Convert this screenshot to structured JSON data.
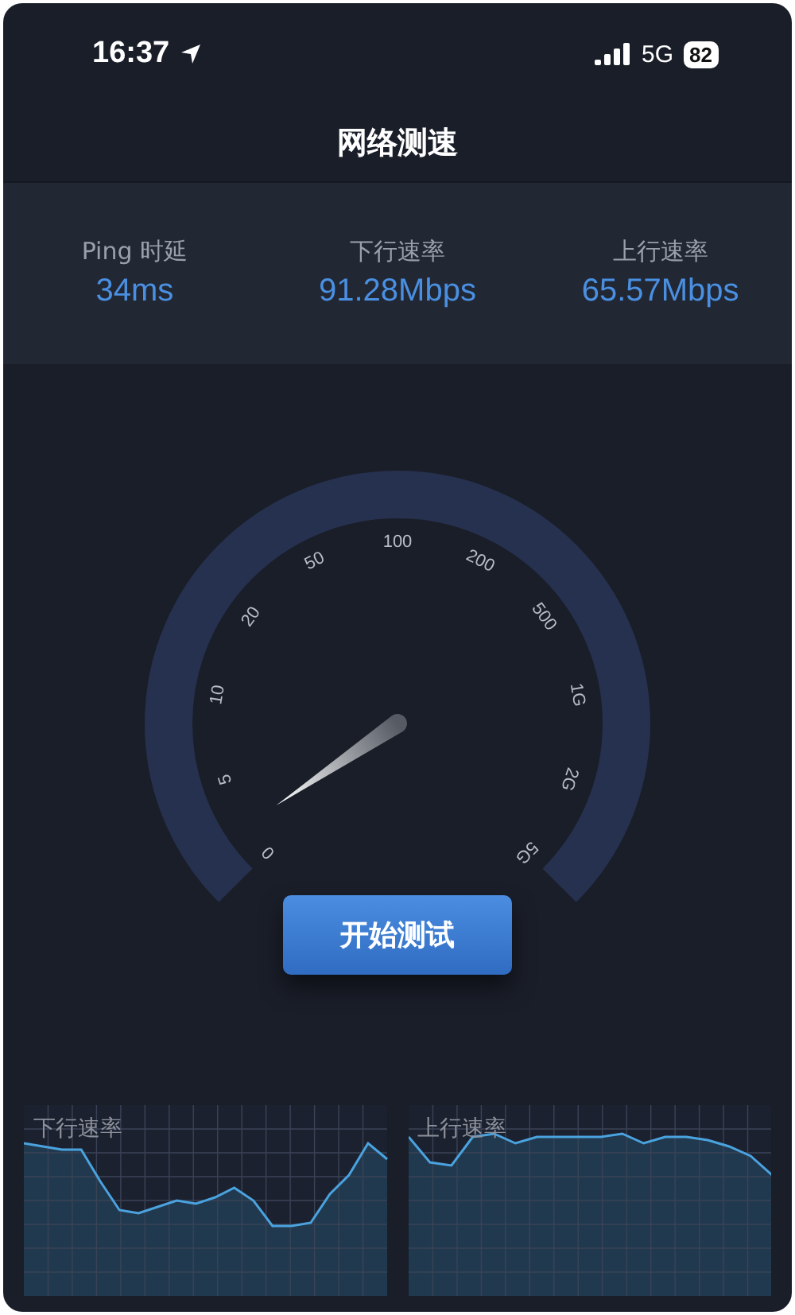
{
  "status_bar": {
    "time": "16:37",
    "network": "5G",
    "battery": "82"
  },
  "title": "网络测速",
  "stats": [
    {
      "label": "Ping 时延",
      "value": "34ms"
    },
    {
      "label": "下行速率",
      "value": "91.28Mbps"
    },
    {
      "label": "上行速率",
      "value": "65.57Mbps"
    }
  ],
  "gauge": {
    "ticks": [
      "0",
      "5",
      "10",
      "20",
      "50",
      "100",
      "200",
      "500",
      "1G",
      "2G",
      "5G"
    ]
  },
  "start_button": "开始测试",
  "graphs": [
    {
      "label": "下行速率",
      "kind": "download"
    },
    {
      "label": "上行速率",
      "kind": "upload"
    }
  ]
}
